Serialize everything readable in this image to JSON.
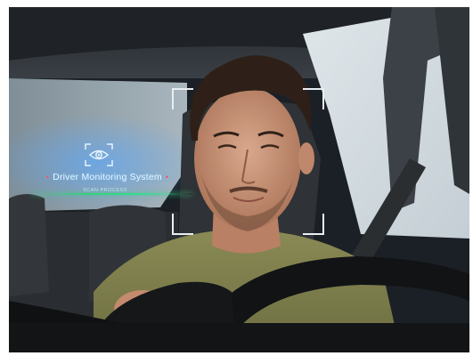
{
  "hud": {
    "icon": "eye-scan-icon",
    "label": "Driver Monitoring System",
    "sublabel": "SCAN PROCESS",
    "accent_color": "#34d27c",
    "dot_color": "#ff4d63"
  },
  "overlay": {
    "bracket_color": "#e9eef2"
  }
}
